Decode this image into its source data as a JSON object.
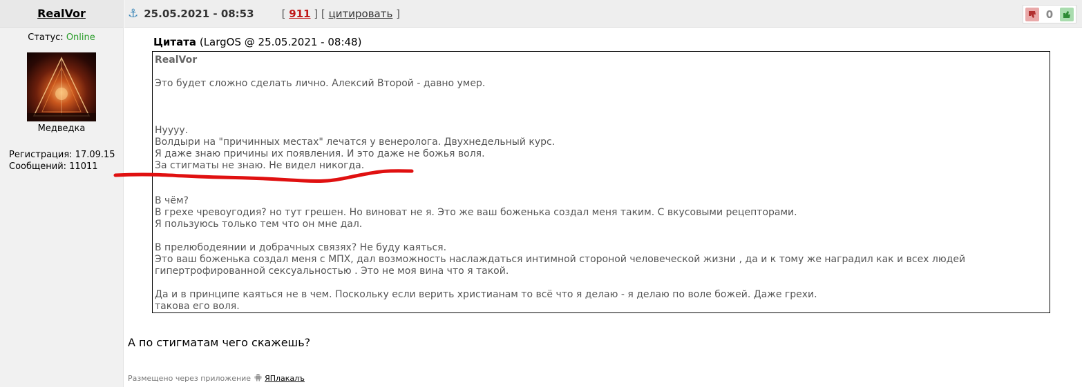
{
  "user": {
    "name": "RealVor",
    "status_label": "Статус:",
    "status_value": "Online",
    "avatar_caption": "Медведка",
    "registration": "Регистрация: 17.09.15",
    "messages": "Сообщений: 11011"
  },
  "post": {
    "date": "25.05.2021 - 08:53",
    "bracket_open": "[",
    "number": "911",
    "bracket_mid": "] [",
    "quote_label": "цитировать",
    "bracket_close": "]",
    "rating": "0"
  },
  "quote": {
    "title": "Цитата",
    "meta": "(LargOS @ 25.05.2021 - 08:48)",
    "author": "RealVor",
    "line1": "Это будет сложно сделать лично. Алексий Второй - давно умер.",
    "para1": [
      "Нуууу.",
      "Волдыри на \"причинных местах\" лечатся у венеролога. Двухнедельный курс.",
      "Я даже знаю причины их появления. И это даже не божья воля.",
      "За стигматы не знаю. Не видел никогда."
    ],
    "para2": [
      "В чём?",
      "В грехе чревоугодия? но тут грешен. Но виноват не я. Это же ваш боженька создал меня таким. С вкусовыми рецепторами.",
      "Я пользуюсь только тем что он мне дал."
    ],
    "para3": [
      "В прелюбодеянии и добрачных связях? Не буду каяться.",
      "Это ваш боженька создал меня с МПХ, дал возможность наслаждаться интимной стороной человеческой жизни , да и к тому же наградил как и всех людей",
      "гипертрофированной сексуальностью . Это не моя вина что я такой."
    ],
    "para4": [
      "Да и в принципе каяться не в чем. Поскольку если верить христианам то всё что я делаю - я делаю по воле божей. Даже грехи.",
      "такова его воля."
    ]
  },
  "reply": "А по стигматам чего скажешь?",
  "footer": {
    "prefix": "Размещено через приложение",
    "app": "ЯПлакалъ"
  },
  "colors": {
    "online": "#2a9d2a",
    "post_number": "#c01818",
    "annotation": "#e01010",
    "anchor": "#3a86b8"
  }
}
